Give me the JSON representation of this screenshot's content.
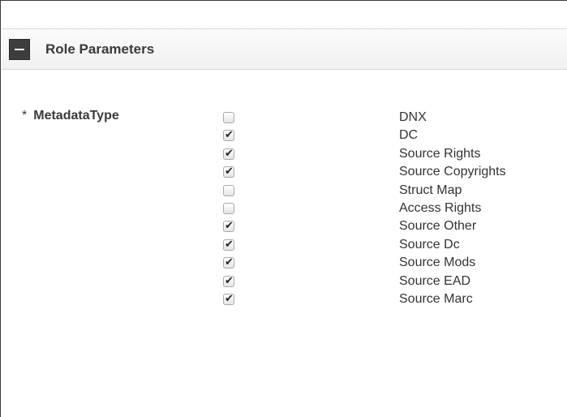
{
  "section": {
    "title": "Role Parameters"
  },
  "field": {
    "required_marker": "*",
    "label": "MetadataType"
  },
  "options": [
    {
      "label": "DNX",
      "checked": false
    },
    {
      "label": "DC",
      "checked": true
    },
    {
      "label": "Source Rights",
      "checked": true
    },
    {
      "label": "Source Copyrights",
      "checked": true
    },
    {
      "label": "Struct Map",
      "checked": false
    },
    {
      "label": "Access Rights",
      "checked": false
    },
    {
      "label": "Source Other",
      "checked": true
    },
    {
      "label": "Source Dc",
      "checked": true
    },
    {
      "label": "Source Mods",
      "checked": true
    },
    {
      "label": "Source EAD",
      "checked": true
    },
    {
      "label": "Source Marc",
      "checked": true
    }
  ],
  "icons": {
    "collapse": "minus-icon",
    "check": "check-icon"
  }
}
